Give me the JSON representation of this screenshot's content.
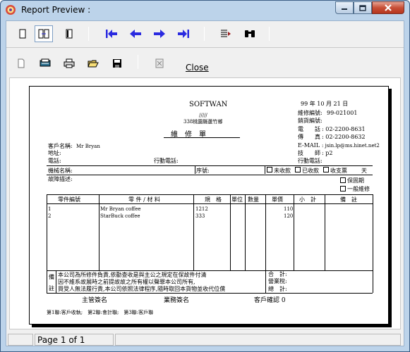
{
  "window": {
    "title": "Report Preview :",
    "colors": {
      "frame": "#bcd3ea",
      "close": "#c74f37",
      "nav_arrow": "#2a2ae0"
    }
  },
  "toolbar1": {
    "buttons": [
      "one-page-view-icon",
      "two-page-view-icon",
      "page-width-icon",
      "first-page-icon",
      "previous-page-icon",
      "next-page-icon",
      "last-page-icon",
      "go-to-page-icon",
      "find-icon"
    ]
  },
  "toolbar2": {
    "buttons": [
      "new-document-icon",
      "setup-icon",
      "print-icon",
      "open-icon",
      "save-icon",
      "export-icon"
    ],
    "close_label": "Close"
  },
  "status": {
    "page": "Page 1 of 1"
  },
  "report": {
    "company": "SOFTWAN",
    "sub1": "/////",
    "sub2": "338桃園縣蘆竹鄉",
    "form_title": "維　修　單",
    "date": "99 年 10 月 21 日",
    "repair_no_label": "維修編號:",
    "repair_no": "99-021001",
    "sales_no_label": "銷貨編號:",
    "tel_label": "電　　話",
    "tel": ": 02-2200-8631",
    "fax_label": "傳　　真",
    "fax": ": 02-2200-8632",
    "email_label": "E-MAIL",
    "email": ": jsin.lp@ms.hinet.net2",
    "tech_label": "技　　師",
    "tech": ": p2",
    "mobile_label": "行動電話:",
    "customer_label": "客戶名稱:",
    "customer": "Mr Bryan",
    "address_label": "地址:",
    "phone_label": "電話:",
    "mobile2_label": "行動電話:",
    "model_label": "機械名稱:",
    "serial_label": "序號:",
    "opt1": "未收款",
    "opt2": "已收款",
    "opt3": "收支票",
    "opt4": "天",
    "fault_label": "故障描述:",
    "opt5": "保固期",
    "opt6": "一般維修",
    "columns": [
      "零件編號",
      "零 件 / 材 料",
      "規　格",
      "單位",
      "數量",
      "單價",
      "小　計",
      "備　註"
    ],
    "rows": [
      {
        "no": "1",
        "name": "Mr Bryan coffee",
        "spec": "1212",
        "price": "110"
      },
      {
        "no": "2",
        "name": "StarBuck coffee",
        "spec": "333",
        "price": "120"
      }
    ],
    "note_label_1": "備",
    "note_label_2": "註",
    "note_1": "本公司為所修件負責,依勸查收是與主公之規定在保故件付清",
    "note_2": "因不維系故展時之前提故故之所有權以聲罪本公司所有,",
    "note_3": "買受人無法履行責,本公司依照法律程序,隨時取回本貨物並收代位償",
    "total_label": "合　計:",
    "tax_label": "營業稅:",
    "grand_label": "總　計:",
    "sig1": "主管簽名",
    "sig2": "業務簽名",
    "sig3": "客戶確認 0",
    "footer": "第1聯:客戶收執;　第2聯:會計聯;　第3聯:客戶聯"
  }
}
